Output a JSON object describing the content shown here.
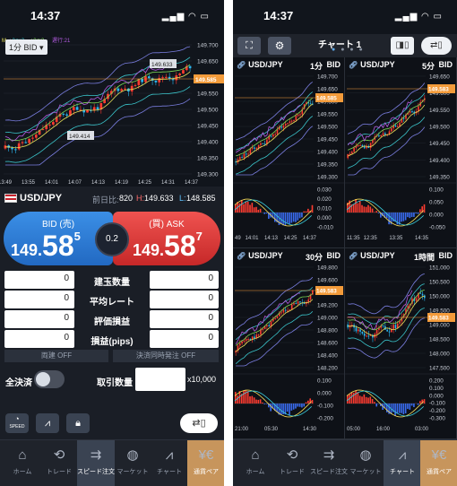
{
  "status_time": "14:37",
  "left": {
    "chart": {
      "timeframe_select": "1分 BID",
      "indicators": [
        "M",
        "+2σ±3",
        "±3σ:3",
        "遅行:21"
      ],
      "price_ticks": [
        "149.700",
        "149.650",
        "149.600",
        "149.550",
        "149.500",
        "149.450",
        "149.400",
        "149.350",
        "149.300"
      ],
      "time_ticks": [
        "13:49",
        "13:55",
        "14:01",
        "14:07",
        "14:13",
        "14:19",
        "14:25",
        "14:31",
        "14:37"
      ],
      "high_marker": "149.633",
      "low_marker": "149.414",
      "current_marker": "149.585"
    },
    "pair": {
      "name": "USD/JPY",
      "prev_label": "前日比:",
      "prev_value": "820",
      "high_label": "H:",
      "high_value": "149.633",
      "low_label": "L:",
      "low_value": "148.585"
    },
    "bid": {
      "label": "BID (売)",
      "big": "149.",
      "main": "58",
      "pip": "5"
    },
    "ask": {
      "label": "(買) ASK",
      "big": "149.",
      "main": "58",
      "pip": "7"
    },
    "spread": "0.2",
    "stats": [
      {
        "label": "建玉数量",
        "left": "0",
        "right": "0"
      },
      {
        "label": "平均レート",
        "left": "0",
        "right": "0"
      },
      {
        "label": "評価損益",
        "left": "0",
        "right": "0"
      },
      {
        "label": "損益(pips)",
        "left": "0",
        "right": "0"
      }
    ],
    "off_left": "両建 OFF",
    "off_right": "決済同時発注 OFF",
    "close_all": "全決済",
    "qty_label": "取引数量",
    "qty_value": "",
    "qty_unit": "x10,000",
    "speed_label": "SPEED"
  },
  "right": {
    "title": "チャート 1",
    "panels": [
      {
        "pair": "USD/JPY",
        "timeframe": "1分",
        "side": "BID",
        "price_ticks": [
          "149.700",
          "149.650",
          "149.600",
          "149.550",
          "149.500",
          "149.450",
          "149.400",
          "149.350",
          "149.300"
        ],
        "current": "149.585",
        "osc_ticks": [
          "0.030",
          "0.020",
          "0.010",
          "0.000",
          "-0.010"
        ],
        "time_ticks": [
          "49",
          "14:01",
          "14:13",
          "14:25",
          "14:37"
        ]
      },
      {
        "pair": "USD/JPY",
        "timeframe": "5分",
        "side": "BID",
        "price_ticks": [
          "149.650",
          "149.600",
          "149.550",
          "149.500",
          "149.450",
          "149.400",
          "149.350"
        ],
        "current": "149.583",
        "osc_ticks": [
          "0.100",
          "0.050",
          "0.000",
          "-0.050"
        ],
        "time_ticks": [
          "11:35",
          "12:35",
          "13:35",
          "14:35"
        ]
      },
      {
        "pair": "USD/JPY",
        "timeframe": "30分",
        "side": "BID",
        "price_ticks": [
          "149.800",
          "149.600",
          "149.400",
          "149.200",
          "149.000",
          "148.800",
          "148.600",
          "148.400",
          "148.200"
        ],
        "current": "149.583",
        "osc_ticks": [
          "0.100",
          "0.000",
          "-0.100",
          "-0.200"
        ],
        "time_ticks": [
          "21:00",
          "05:30",
          "14:30"
        ]
      },
      {
        "pair": "USD/JPY",
        "timeframe": "1時間",
        "side": "BID",
        "price_ticks": [
          "151.000",
          "150.500",
          "150.000",
          "149.500",
          "149.000",
          "148.500",
          "148.000",
          "147.500"
        ],
        "current": "149.583",
        "osc_ticks": [
          "0.200",
          "0.100",
          "0.000",
          "-0.100",
          "-0.200",
          "-0.300"
        ],
        "time_ticks": [
          "05:00",
          "16:00",
          "03:00"
        ]
      }
    ]
  },
  "tabs_left": [
    {
      "label": "ホーム",
      "icon": "home-icon"
    },
    {
      "label": "トレード",
      "icon": "trade-icon"
    },
    {
      "label": "スピード注文",
      "icon": "speed-order-icon"
    },
    {
      "label": "マーケット",
      "icon": "market-icon"
    },
    {
      "label": "チャート",
      "icon": "chart-icon"
    },
    {
      "label": "通貨ペア",
      "icon": "currency-pair-icon"
    }
  ],
  "tabs_right": [
    {
      "label": "ホーム",
      "icon": "home-icon"
    },
    {
      "label": "トレード",
      "icon": "trade-icon"
    },
    {
      "label": "スピード注文",
      "icon": "speed-order-icon"
    },
    {
      "label": "マーケット",
      "icon": "market-icon"
    },
    {
      "label": "チャート",
      "icon": "chart-icon"
    },
    {
      "label": "通貨ペア",
      "icon": "currency-pair-icon"
    }
  ],
  "colors": {
    "bid_blue": "#2f7fd8",
    "ask_red": "#e0413f",
    "candle_up": "#ff3b30",
    "candle_down": "#2bb6f0",
    "current_price": "#f39b3a"
  }
}
